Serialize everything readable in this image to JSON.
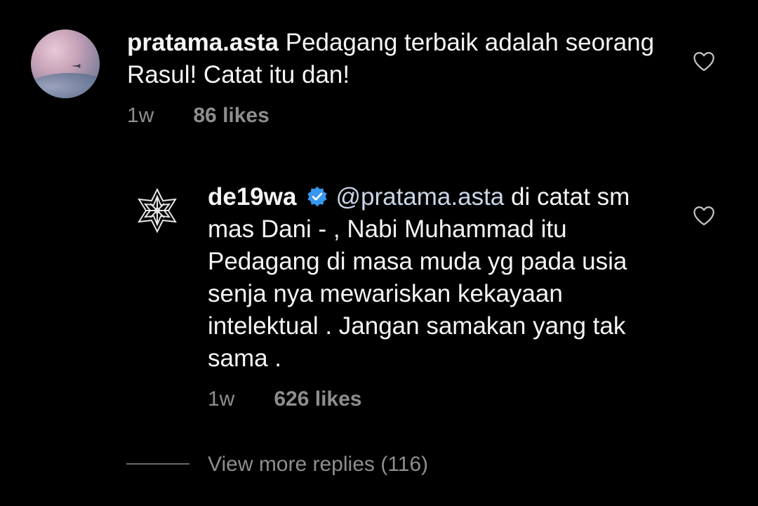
{
  "comment": {
    "username": "pratama.asta",
    "text": "Pedagang terbaik adalah seorang Rasul!  Catat itu dan!",
    "time": "1w",
    "likes": "86 likes",
    "avatar_icon": "airplane-sky-avatar",
    "like_icon": "heart-outline-icon"
  },
  "reply": {
    "username": "de19wa",
    "verified_icon": "verified-badge-icon",
    "mention": "@pratama.asta",
    "text": " di catat sm mas Dani - , Nabi Muhammad itu Pedagang di masa muda yg pada usia senja nya mewariskan kekayaan intelektual . Jangan samakan yang tak sama .",
    "time": "1w",
    "likes": "626 likes",
    "like_icon": "heart-outline-icon"
  },
  "view_more": {
    "label": "View more replies (116)"
  },
  "colors": {
    "background": "#000000",
    "text": "#f5f5f5",
    "meta": "#8e8e8e",
    "verified": "#3897f0"
  }
}
